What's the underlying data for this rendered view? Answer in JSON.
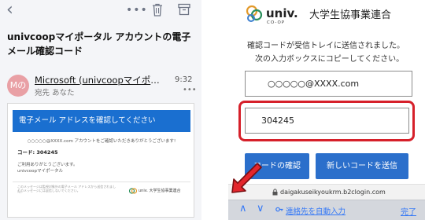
{
  "mail": {
    "subject": "univcoopマイポータル アカウントの電子メール確認コード",
    "sender": {
      "avatar_text": "Mの",
      "name": "Microsoft (univcoopマイポータ…",
      "to": "宛先 あなた",
      "time": "9:32",
      "more": "•••"
    },
    "toolbar": {
      "back_glyph": "‹",
      "more_glyph": "•••"
    },
    "body": {
      "banner": "電子メール アドレスを確認してください",
      "email_line": "○○○○○@XXXX.com アカウントをご確認いただきありがとうございます!",
      "code_line": "コード: 304245",
      "thanks_1": "ご利用ありがとうございます。",
      "thanks_2": "univcoopマイポータル",
      "footer_1": "このメッセージは監視対象外の電子メール アドレスから送信されました。",
      "footer_2": "このメッセージには返信しないでください。",
      "logo_text": "univ. 大学生協事業連合"
    }
  },
  "verify_page": {
    "brand": {
      "latin": "univ.",
      "sub": "CO-OP",
      "japanese": "大学生協事業連合"
    },
    "info_line_1": "確認コードが受信トレイに送信されました。",
    "info_line_2": "次の入力ボックスにコピーしてください。",
    "email_value": "○○○○○@XXXX.com",
    "code_value": "304245",
    "verify_button": "コードの確認",
    "resend_button": "新しいコードを送信",
    "url": "daigakuseikyoukrm.b2clogin.com",
    "keyboard_bar": {
      "up": "∧",
      "down": "∨",
      "autofill": "連絡先を自動入力",
      "done": "完了"
    }
  },
  "colors": {
    "primary_blue": "#2b6fcb",
    "banner_blue": "#1a6fd0",
    "highlight_red": "#d6202a",
    "link_blue": "#3478f6",
    "avatar_pink": "#e9a0a5"
  }
}
